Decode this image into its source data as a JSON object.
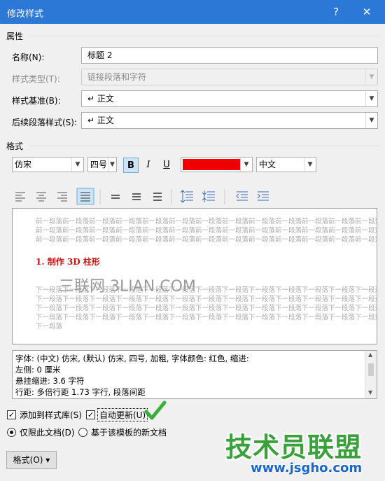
{
  "window": {
    "title": "修改样式",
    "help_btn": "?",
    "close_btn": "✕"
  },
  "properties": {
    "group_label": "属性",
    "name_label": "名称(N):",
    "name_value": "标题 2",
    "style_type_label": "样式类型(T):",
    "style_type_value": "链接段落和字符",
    "based_on_label": "样式基准(B):",
    "based_on_value": "↵ 正文",
    "next_label": "后续段落样式(S):",
    "next_value": "↵ 正文"
  },
  "format": {
    "group_label": "格式",
    "font": "仿宋",
    "size": "四号",
    "bold": "B",
    "italic": "I",
    "underline": "U",
    "font_color": "#ee0000",
    "script": "中文"
  },
  "preview": {
    "before_lines": [
      "前一段落前一段落前一段落前一段落前一段落前一段落前一段落前一段落前一段落前一段落前一段落前一段落前一段落前一段落前一段落前一段落前一段落",
      "前一段落前一段落前一段落前一段落前一段落前一段落前一段落前一段落前一段落前一段落前一段落前一段落前一段落前一段落前一段落前一段落前一段落",
      "前一段落前一段落前一段落前一段落前一段落前一段落前一段落前一段落前一段落前一段落前一段落前一段落前一段落前一段落前一段落前一段落前一段落"
    ],
    "sample": "1. 制作 3D 柱形",
    "watermark": "三联网 3LIAN.COM",
    "after_lines": [
      "下一段落下一段落下一段落下一段落下一段落下一段落下一段落下一段落下一段落下一段落下一段落下一段落下一段落下一段落下一段落下一段落下一段落",
      "下一段落下一段落下一段落下一段落下一段落下一段落下一段落下一段落下一段落下一段落下一段落下一段落下一段落下一段落下一段落下一段落下一段落",
      "下一段落下一段落下一段落下一段落下一段落下一段落下一段落下一段落下一段落下一段落下一段落下一段落下一段落下一段落下一段落下一段落下一段落",
      "下一段落下一段落下一段落下一段落下一段落下一段落下一段落下一段落下一段落下一段落下一段落下一段落下一段落下一段落下一段落下一段落下一段落",
      "下一段落"
    ]
  },
  "description": {
    "lines": [
      "字体: (中文) 仿宋, (默认) 仿宋, 四号, 加粗, 字体颜色: 红色, 缩进:",
      "    左侧:  0 厘米",
      "    悬挂缩进: 3.6 字符",
      "    行距: 多倍行距 1.73 字行, 段落间距"
    ]
  },
  "options": {
    "add_to_gallery": "添加到样式库(S)",
    "auto_update": "自动更新(U)",
    "this_doc_only": "仅限此文档(D)",
    "new_docs_template": "基于该模板的新文档",
    "check_mark": "✓"
  },
  "footer": {
    "format_button": "格式(O) ▾",
    "watermark_main": "技术员联盟",
    "watermark_url": "www.jsgho.com"
  }
}
